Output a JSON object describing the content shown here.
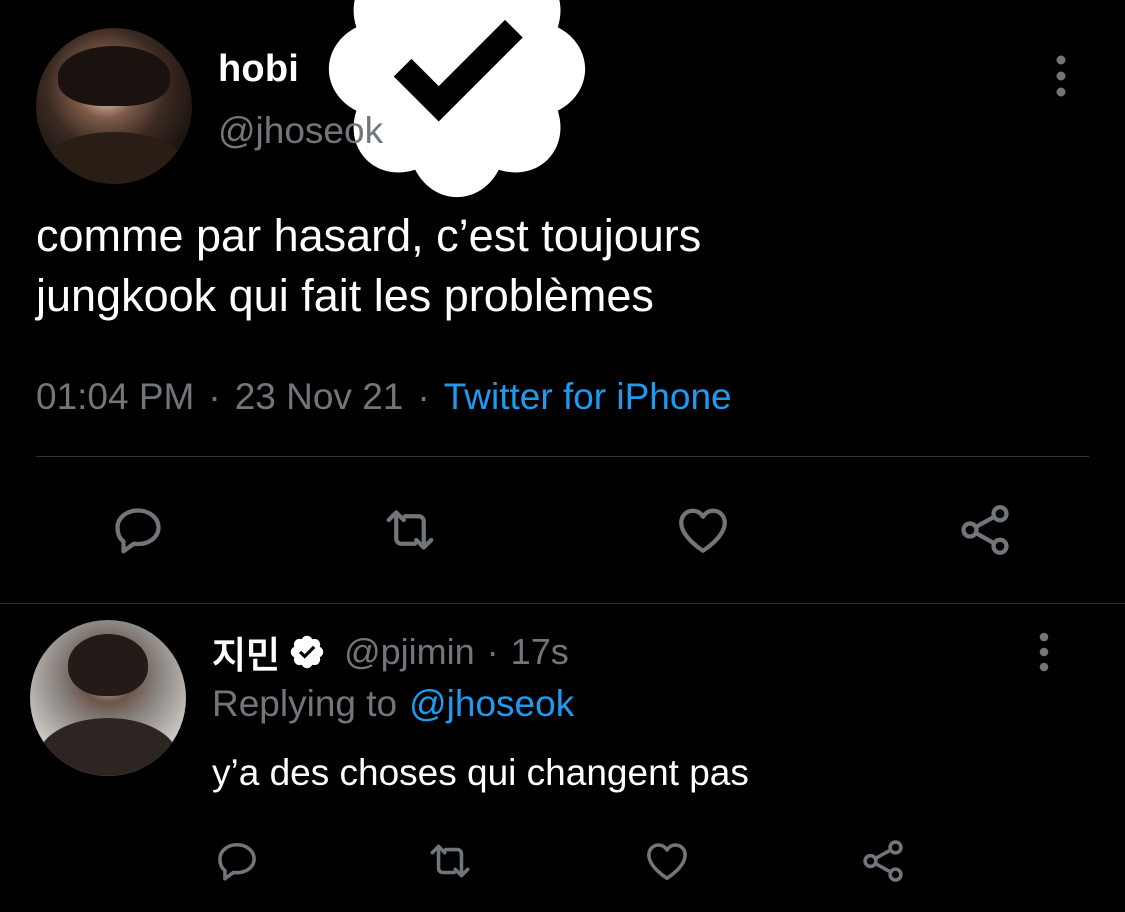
{
  "main_tweet": {
    "author_name": "hobi",
    "handle": "@jhoseok",
    "verified": true,
    "text": "comme par hasard, c’est toujours\njungkook qui fait les problèmes",
    "time": "01:04 PM",
    "date": "23 Nov 21",
    "separator": "·",
    "source": "Twitter for iPhone",
    "actions": [
      "reply-icon",
      "retweet-icon",
      "like-icon",
      "share-icon"
    ]
  },
  "reply_tweet": {
    "author_name": "지민",
    "handle": "@pjimin",
    "verified": true,
    "separator": "·",
    "time_ago": "17s",
    "replying_label": "Replying to",
    "replying_to": "@jhoseok",
    "text": "y’a des choses qui changent pas",
    "actions": [
      "reply-icon",
      "retweet-icon",
      "like-icon",
      "share-icon"
    ]
  },
  "colors": {
    "background": "#000000",
    "primary_text": "#ffffff",
    "secondary_text": "#71767b",
    "accent": "#1d9bf0",
    "divider": "#2f3336",
    "icon": "#71767b"
  }
}
